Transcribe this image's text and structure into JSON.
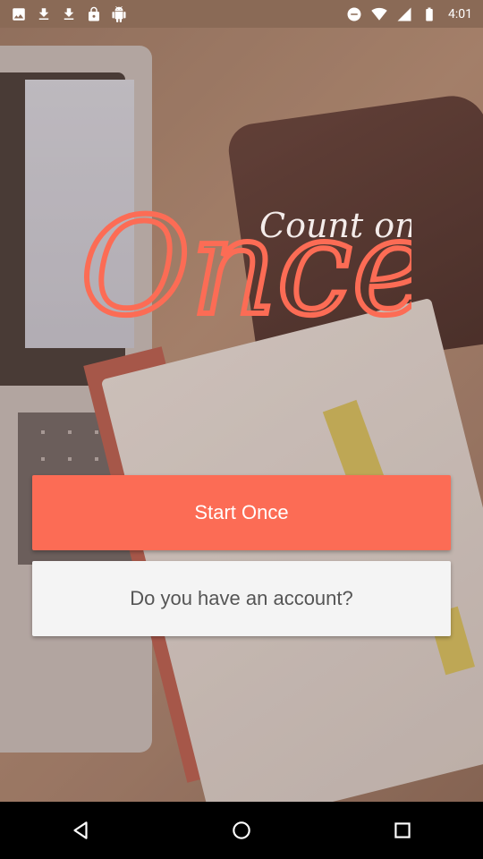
{
  "status_bar": {
    "time": "4:01",
    "left_icons": [
      "image-icon",
      "download-icon",
      "download-icon",
      "lock-icon",
      "android-icon"
    ],
    "right_icons": [
      "dnd-icon",
      "wifi-icon",
      "signal-icon",
      "battery-icon"
    ]
  },
  "logo": {
    "tagline": "Count on",
    "wordmark": "Once",
    "color": "#fc6c55"
  },
  "buttons": {
    "start_label": "Start Once",
    "account_label": "Do you have an account?"
  },
  "colors": {
    "primary": "#fc6c55",
    "secondary_button": "#f4f4f4"
  },
  "nav_bar": {
    "icons": [
      "back-icon",
      "home-icon",
      "recents-icon"
    ]
  }
}
